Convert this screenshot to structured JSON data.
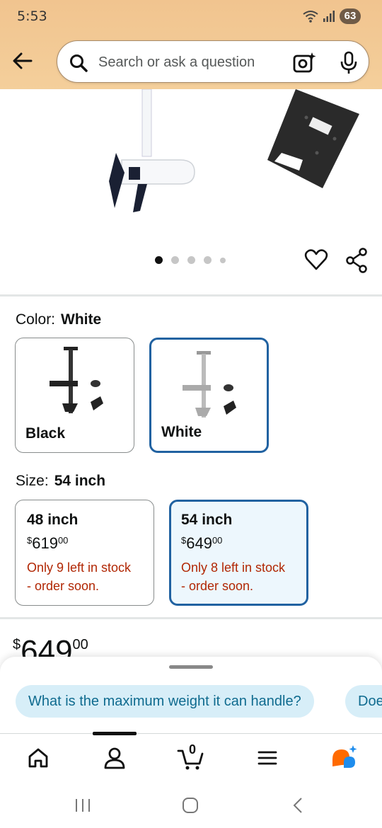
{
  "status": {
    "time": "5:53",
    "battery": "63"
  },
  "search": {
    "placeholder": "Search or ask a question"
  },
  "gallery": {
    "image_count": 5,
    "active_index": 0
  },
  "color": {
    "label": "Color:",
    "selected": "White",
    "options": [
      {
        "name": "Black"
      },
      {
        "name": "White"
      }
    ]
  },
  "size": {
    "label": "Size:",
    "selected": "54 inch",
    "options": [
      {
        "name": "48 inch",
        "price_symbol": "$",
        "price_whole": "619",
        "price_fraction": "00",
        "stock_line1": "Only 9 left in stock",
        "stock_line2": "- order soon."
      },
      {
        "name": "54 inch",
        "price_symbol": "$",
        "price_whole": "649",
        "price_fraction": "00",
        "stock_line1": "Only 8 left in stock",
        "stock_line2": "- order soon."
      }
    ]
  },
  "price": {
    "symbol": "$",
    "whole": "649",
    "fraction": "00"
  },
  "suggestions": [
    "What is the maximum weight it can handle?",
    "Doe"
  ],
  "nav": {
    "cart_count": "0"
  },
  "colors": {
    "accent_border": "#2162a1",
    "stock_red": "#b12704",
    "chip_bg": "#d7eef8",
    "chip_text": "#0f6b8f"
  }
}
